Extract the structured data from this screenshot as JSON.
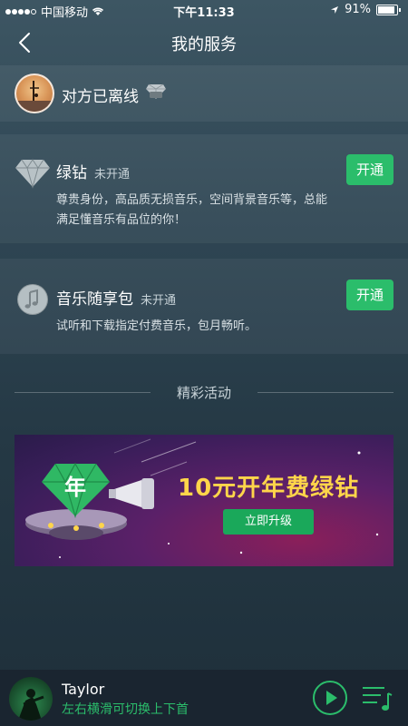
{
  "status_bar": {
    "carrier": "中国移动",
    "time": "下午11:33",
    "battery": "91%"
  },
  "nav": {
    "title": "我的服务"
  },
  "user": {
    "name": "对方已离线"
  },
  "services": [
    {
      "name": "绿钻",
      "status": "未开通",
      "description": "尊贵身份，高品质无损音乐，空间背景音乐等，总能满足懂音乐有品位的你！",
      "button": "开通"
    },
    {
      "name": "音乐随享包",
      "status": "未开通",
      "description": "试听和下载指定付费音乐，包月畅听。",
      "button": "开通"
    }
  ],
  "section": {
    "title": "精彩活动"
  },
  "banner": {
    "headline": "10元开年费绿钻",
    "button": "立即升级",
    "gem_char": "年"
  },
  "player": {
    "song": "Taylor",
    "hint": "左右横滑可切换上下首"
  },
  "colors": {
    "accent": "#2bbd6b",
    "banner_text": "#ffd54a"
  }
}
